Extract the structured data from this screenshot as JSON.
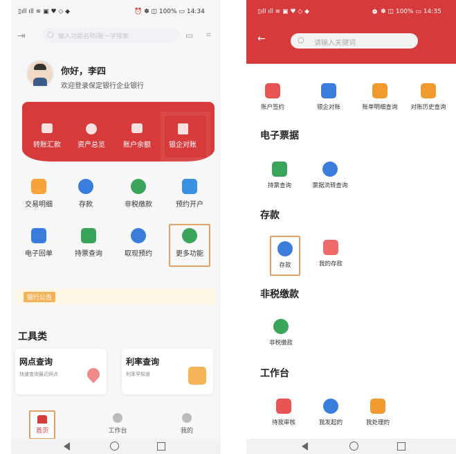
{
  "left": {
    "status_bar": {
      "time": "14:34",
      "battery": "100%"
    },
    "search": {
      "placeholder": "输入功能名称/账一字搜索"
    },
    "greeting": "你好，李四",
    "welcome": "欢迎登录保定银行企业银行",
    "banner_items": [
      "转账汇款",
      "资产总览",
      "账户余额",
      "银企对账"
    ],
    "grid_items": [
      "交易明细",
      "存款",
      "非税缴款",
      "预约开户",
      "电子回单",
      "持票查询",
      "取现预约",
      "更多功能"
    ],
    "notice_label": "银行公告",
    "tools_title": "工具类",
    "card1": {
      "title": "网点查询",
      "desc": "快速查询最近网点"
    },
    "card2": {
      "title": "利率查询",
      "desc": "利率早知道"
    },
    "tabs": [
      "首页",
      "工作台",
      "我的"
    ]
  },
  "right": {
    "status_bar": {
      "time": "14:35",
      "battery": "100%"
    },
    "search": {
      "placeholder": "请输入关键词"
    },
    "row1": [
      "账户签约",
      "银企对账",
      "账单明细查询",
      "对账历史查询"
    ],
    "sections": {
      "bills": {
        "title": "电子票据",
        "items": [
          "持票查询",
          "票据流转查询"
        ]
      },
      "deposit": {
        "title": "存款",
        "items": [
          "存款",
          "我的存款"
        ]
      },
      "tax": {
        "title": "非税缴款",
        "items": [
          "非税缴款"
        ]
      },
      "workbench": {
        "title": "工作台",
        "items": [
          "待我审核",
          "我发起的",
          "我处理的"
        ]
      }
    }
  },
  "colors": {
    "brand_red": "#d73a3a",
    "highlight": "#e0a06a",
    "icon_blue": "#3b7ddd",
    "icon_green": "#3aa55a",
    "icon_orange": "#f09a30"
  }
}
